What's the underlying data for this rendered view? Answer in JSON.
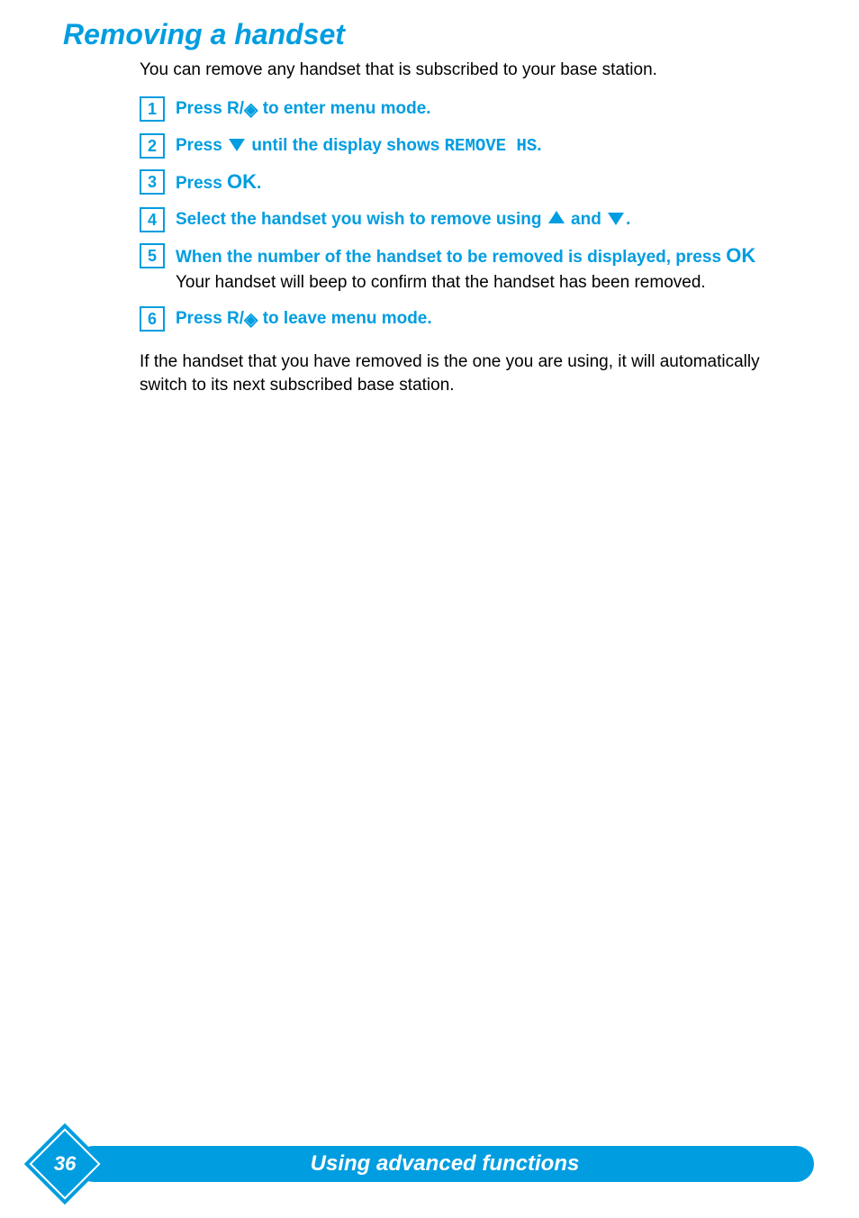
{
  "title": "Removing a handset",
  "intro": "You can remove any handset that is subscribed to your base station.",
  "steps": [
    {
      "n": "1",
      "prefix": "Press ",
      "r": "R/",
      "diamond": true,
      "suffix": " to enter menu mode."
    },
    {
      "n": "2",
      "prefix": "Press ",
      "tri_down": true,
      "mid": " until the display shows ",
      "mono": "REMOVE HS",
      "suffix": "."
    },
    {
      "n": "3",
      "prefix": "Press ",
      "ok": "OK",
      "suffix": "."
    },
    {
      "n": "4",
      "prefix": "Select the handset you wish to remove using ",
      "tri_up": true,
      "mid": " and ",
      "tri_down2": true,
      "suffix": "."
    },
    {
      "n": "5",
      "prefix": "When the number of the handset to be removed is displayed, press ",
      "ok": "OK",
      "black": "Your handset will beep to confirm that the handset has been removed."
    },
    {
      "n": "6",
      "prefix": "Press ",
      "r": "R/",
      "diamond": true,
      "suffix": " to leave menu mode."
    }
  ],
  "closing": "If the handset that you have removed is the one you are using, it will automatically switch to its next subscribed base station.",
  "footer": {
    "page": "36",
    "label": "Using advanced functions"
  }
}
